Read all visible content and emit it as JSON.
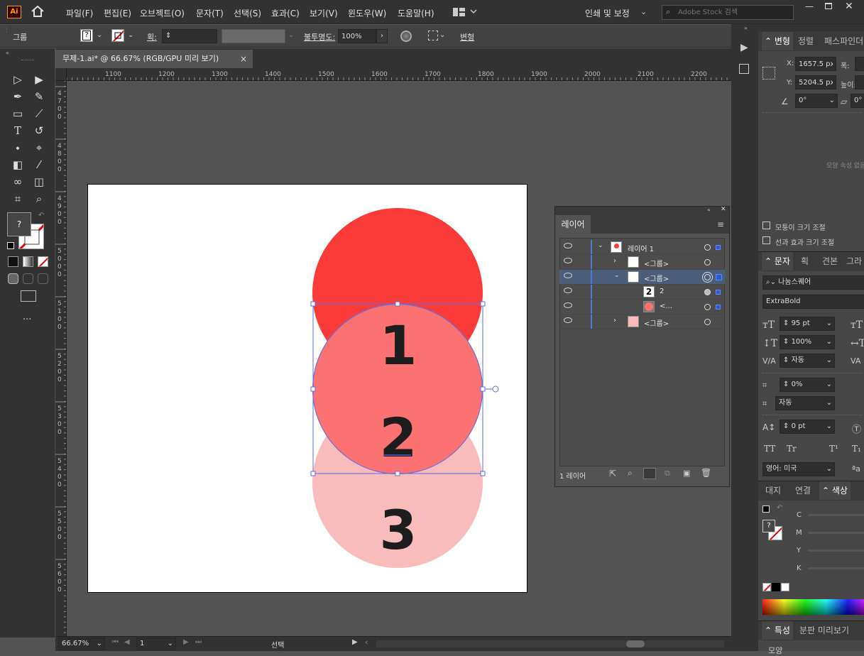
{
  "app": {
    "logo": "Ai"
  },
  "menu": [
    "파일(F)",
    "편집(E)",
    "오브젝트(O)",
    "문자(T)",
    "선택(S)",
    "효과(C)",
    "보기(V)",
    "윈도우(W)",
    "도움말(H)"
  ],
  "workspace": "인쇄 및 보정",
  "search": {
    "placeholder": "Adobe Stock 검색"
  },
  "control": {
    "selection_type": "그룹",
    "stroke_label": "획:",
    "opacity_label": "불투명도:",
    "opacity_value": "100%",
    "transform_label": "변형"
  },
  "document": {
    "tab_title": "무제-1.ai* @ 66.67% (RGB/GPU 미리 보기)",
    "close": "×"
  },
  "ruler_top": [
    "1100",
    "1200",
    "1300",
    "1400",
    "1500",
    "1600",
    "1700",
    "1800",
    "1900",
    "2000",
    "2100",
    "2200"
  ],
  "ruler_left": [
    {
      "t": "4700"
    },
    {
      "t": "4800"
    },
    {
      "t": "4900"
    },
    {
      "t": "5000"
    },
    {
      "t": "5100"
    },
    {
      "t": "5200"
    },
    {
      "t": "5300"
    },
    {
      "t": "5400"
    },
    {
      "t": "5500"
    },
    {
      "t": "5600"
    }
  ],
  "artwork": {
    "circles": [
      {
        "label": "1",
        "color": "#fb3a3a"
      },
      {
        "label": "2",
        "color": "#fc7272"
      },
      {
        "label": "3",
        "color": "#f9bcbc"
      }
    ]
  },
  "layers_panel": {
    "title": "레이어",
    "rows": [
      {
        "name": "레이어 1"
      },
      {
        "name": "<그룹>"
      },
      {
        "name": "<그룹>"
      },
      {
        "name": "2"
      },
      {
        "name": "<..."
      },
      {
        "name": "<그룹>"
      }
    ],
    "footer": "1 레이어"
  },
  "properties": {
    "tabs": [
      "변형",
      "정렬",
      "패스파인더"
    ],
    "x_label": "X:",
    "x_value": "1657.5 px",
    "y_label": "Y:",
    "y_value": "5204.5 px",
    "w_label": "폭:",
    "h_label": "높이:",
    "angle_value": "0°",
    "shear_value": "0°",
    "no_properties": "모양 속성 없음",
    "scale_corners": "모퉁이 크기 조절",
    "scale_strokes": "선과 효과 크기 조절"
  },
  "character": {
    "tabs": [
      "문자",
      "획",
      "견본",
      "그라"
    ],
    "font": "나눔스퀘어",
    "style": "ExtraBold",
    "size": "95 pt",
    "scale": "100%",
    "kerning": "자동",
    "tracking": "0%",
    "leading": "자동",
    "baseline": "0 pt",
    "tt1": "TT",
    "tt2": "Tr",
    "sup": "T¹",
    "sub": "T₁",
    "language": "영어: 미국",
    "aa": "ªa"
  },
  "color": {
    "tabs": [
      "대지",
      "연결",
      "색상"
    ],
    "channels": [
      "C",
      "M",
      "Y",
      "K"
    ]
  },
  "bottom_tabs": [
    "특성",
    "분판 미리보기"
  ],
  "bottom_cut": "모양",
  "status": {
    "zoom": "66.67%",
    "artboard": "1",
    "mode": "선택"
  }
}
